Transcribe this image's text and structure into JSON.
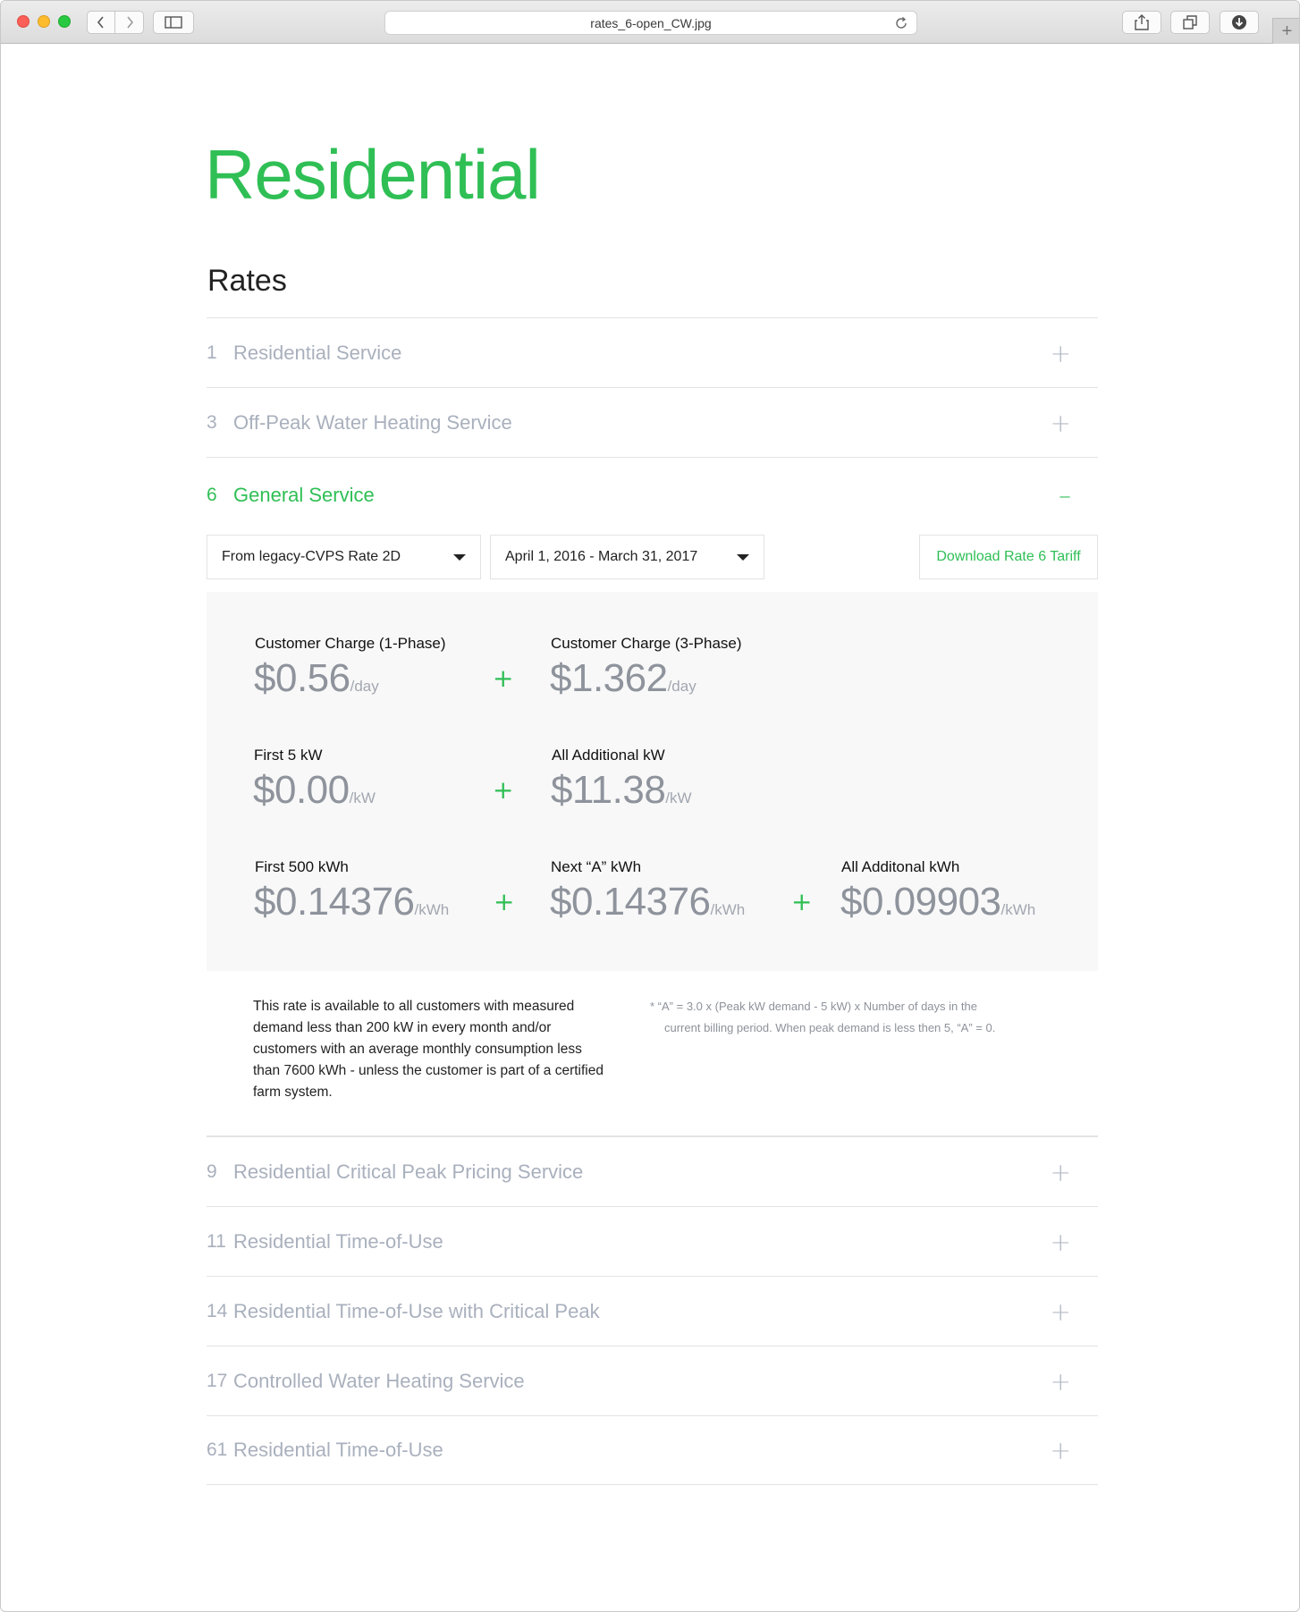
{
  "browser": {
    "url": "rates_6-open_CW.jpg"
  },
  "page": {
    "title": "Residential",
    "section_title": "Rates"
  },
  "rates_list": [
    {
      "number": "1",
      "label": "Residential Service",
      "toggle": "+"
    },
    {
      "number": "3",
      "label": "Off-Peak Water Heating Service",
      "toggle": "+"
    },
    {
      "number": "6",
      "label": "General Service",
      "toggle": "–"
    },
    {
      "number": "9",
      "label": "Residential Critical Peak Pricing Service",
      "toggle": "+"
    },
    {
      "number": "11",
      "label": "Residential Time-of-Use",
      "toggle": "+"
    },
    {
      "number": "14",
      "label": "Residential Time-of-Use with Critical Peak",
      "toggle": "+"
    },
    {
      "number": "17",
      "label": "Controlled Water Heating Service",
      "toggle": "+"
    },
    {
      "number": "61",
      "label": "Residential Time-of-Use",
      "toggle": "+"
    }
  ],
  "open_panel": {
    "rate_select": "From legacy-CVPS Rate 2D",
    "period_select": "April 1, 2016 - March 31, 2017",
    "download_label": "Download Rate 6 Tariff",
    "charges": {
      "cc1": {
        "label": "Customer Charge (1-Phase)",
        "value": "$0.56",
        "unit": "/day"
      },
      "cc3": {
        "label": "Customer Charge (3-Phase)",
        "value": "$1.362",
        "unit": "/day"
      },
      "kw1": {
        "label": "First 5 kW",
        "value": "$0.00",
        "unit": "/kW"
      },
      "kw2": {
        "label": "All Additional kW",
        "value": "$11.38",
        "unit": "/kW"
      },
      "kwh1": {
        "label": "First 500 kWh",
        "value": "$0.14376",
        "unit": "/kWh"
      },
      "kwh2": {
        "label": "Next “A” kWh",
        "value": "$0.14376",
        "unit": "/kWh"
      },
      "kwh3": {
        "label": "All Additonal kWh",
        "value": "$0.09903",
        "unit": "/kWh"
      }
    },
    "plus_sign": "+",
    "description": "This rate is available to all customers with measured demand less than 200 kW in every month and/or customers with an average monthly consumption less than 7600 kWh - unless the customer is part of a certified farm system.",
    "footnote_line1": "* “A” = 3.0 x (Peak kW demand - 5 kW) x Number of days in the",
    "footnote_line2": "current billing period. When peak demand is less then 5, “A” = 0."
  }
}
